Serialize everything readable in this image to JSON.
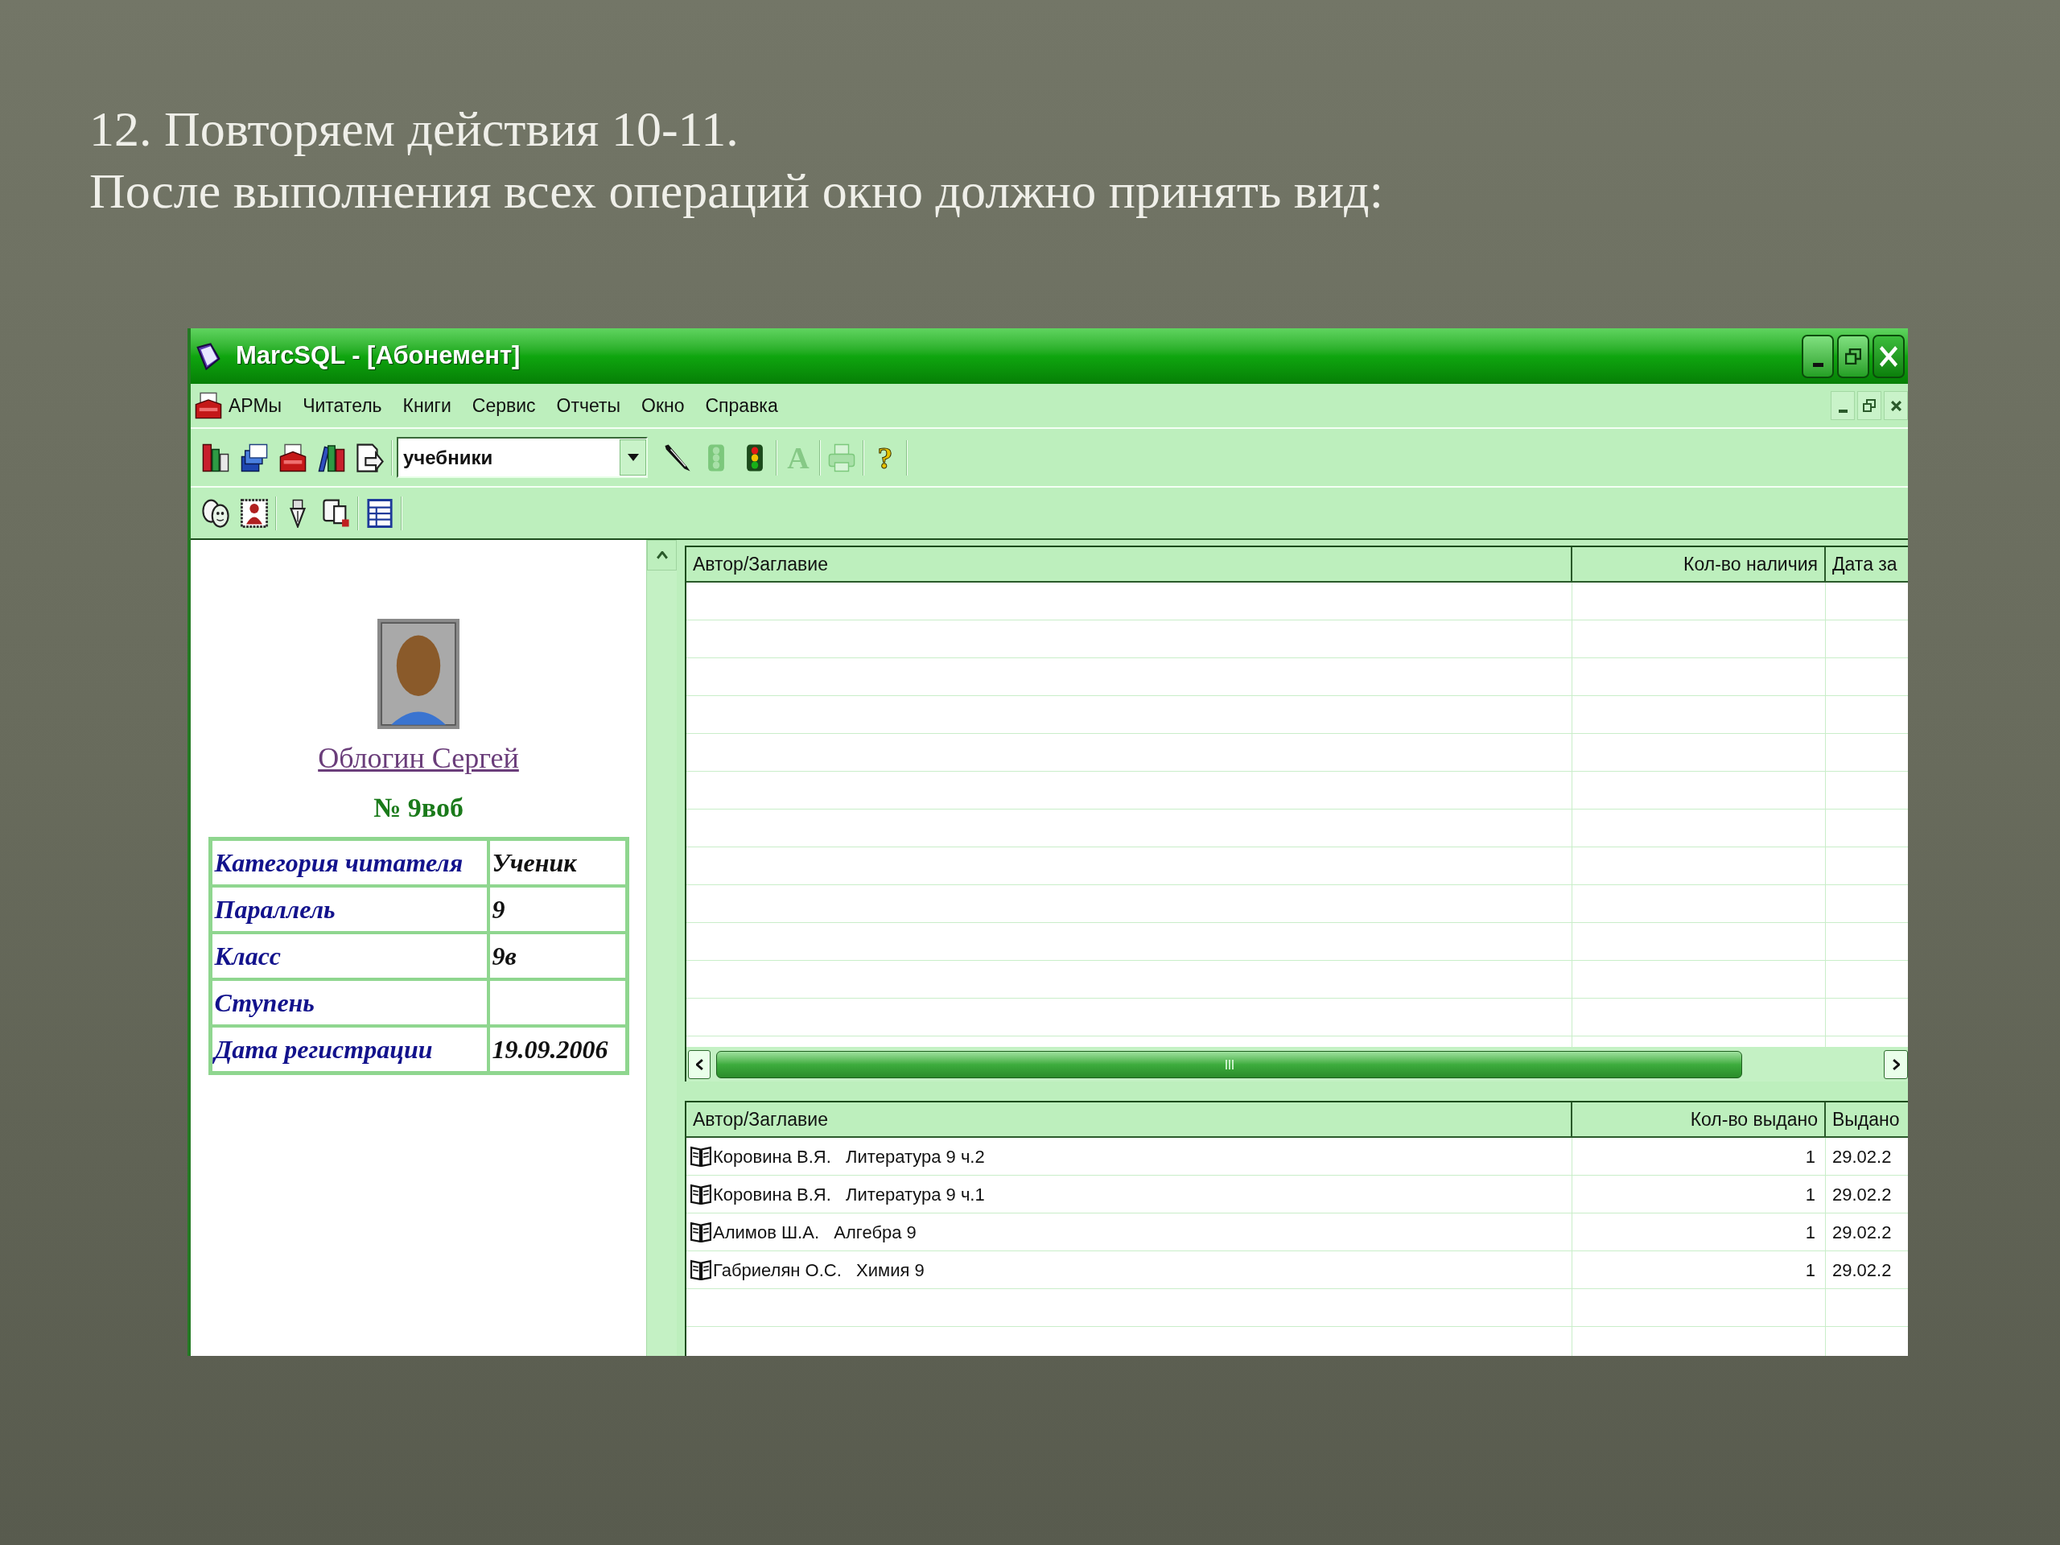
{
  "slide": {
    "lines": [
      "12. Повторяем действия 10-11.",
      "После выполнения всех операций окно должно принять вид:"
    ]
  },
  "window": {
    "title": "MarcSQL - [Абонемент]"
  },
  "menu": {
    "items": [
      "АРМы",
      "Читатель",
      "Книги",
      "Сервис",
      "Отчеты",
      "Окно",
      "Справка"
    ]
  },
  "toolbar_1": {
    "dropdown": {
      "value": "учебники"
    },
    "tools": [
      {
        "disabled": false
      },
      {
        "disabled": true
      },
      {
        "disabled": false
      },
      {
        "label": "A",
        "disabled": true
      },
      {
        "disabled": true
      },
      {
        "label": "?",
        "disabled": false
      }
    ]
  },
  "reader": {
    "name": "Облогин Сергей",
    "number": "№ 9воб",
    "fields": [
      {
        "label": "Категория читателя",
        "value": "Ученик"
      },
      {
        "label": "Параллель",
        "value": "9"
      },
      {
        "label": "Класс",
        "value": "9в"
      },
      {
        "label": "Ступень"
      },
      {
        "label": "Дата регистрации",
        "value": "19.09.2006"
      }
    ]
  },
  "available_table": {
    "columns": [
      "Автор/Заглавие",
      "Кол-во наличия",
      "Дата за"
    ]
  },
  "issued_table": {
    "columns": [
      "Автор/Заглавие",
      "Кол-во выдано",
      "Выдано"
    ],
    "rows": [
      {
        "title": "Коровина В.Я.   Литература 9 ч.2",
        "count": "1",
        "date": "29.02.2"
      },
      {
        "title": "Коровина В.Я.   Литература 9 ч.1",
        "count": "1",
        "date": "29.02.2"
      },
      {
        "title": "Алимов Ш.А.   Алгебра 9",
        "count": "1",
        "date": "29.02.2"
      },
      {
        "title": "Габриелян О.С.   Химия 9",
        "count": "1",
        "date": "29.02.2"
      }
    ]
  }
}
